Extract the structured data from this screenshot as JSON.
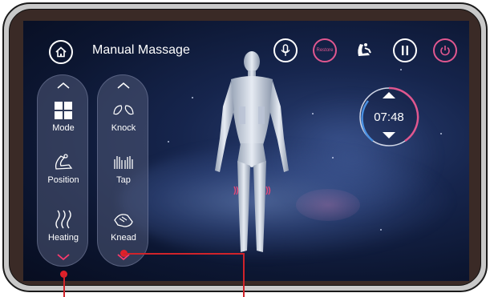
{
  "header": {
    "title": "Manual Massage",
    "restore_label": "Restore"
  },
  "left_panel": {
    "items": [
      {
        "label": "Mode",
        "icon": "grid-icon"
      },
      {
        "label": "Position",
        "icon": "recliner-icon"
      },
      {
        "label": "Heating",
        "icon": "heat-waves-icon"
      }
    ]
  },
  "right_panel": {
    "items": [
      {
        "label": "Knock",
        "icon": "knock-hands-icon"
      },
      {
        "label": "Tap",
        "icon": "tap-hands-icon"
      },
      {
        "label": "Knead",
        "icon": "knead-hand-icon"
      }
    ]
  },
  "timer": {
    "value": "07:48"
  },
  "colors": {
    "accent_pink": "#e0578f",
    "callout_red": "#d0232a",
    "timer_ring_blue": "#4a90e2"
  }
}
